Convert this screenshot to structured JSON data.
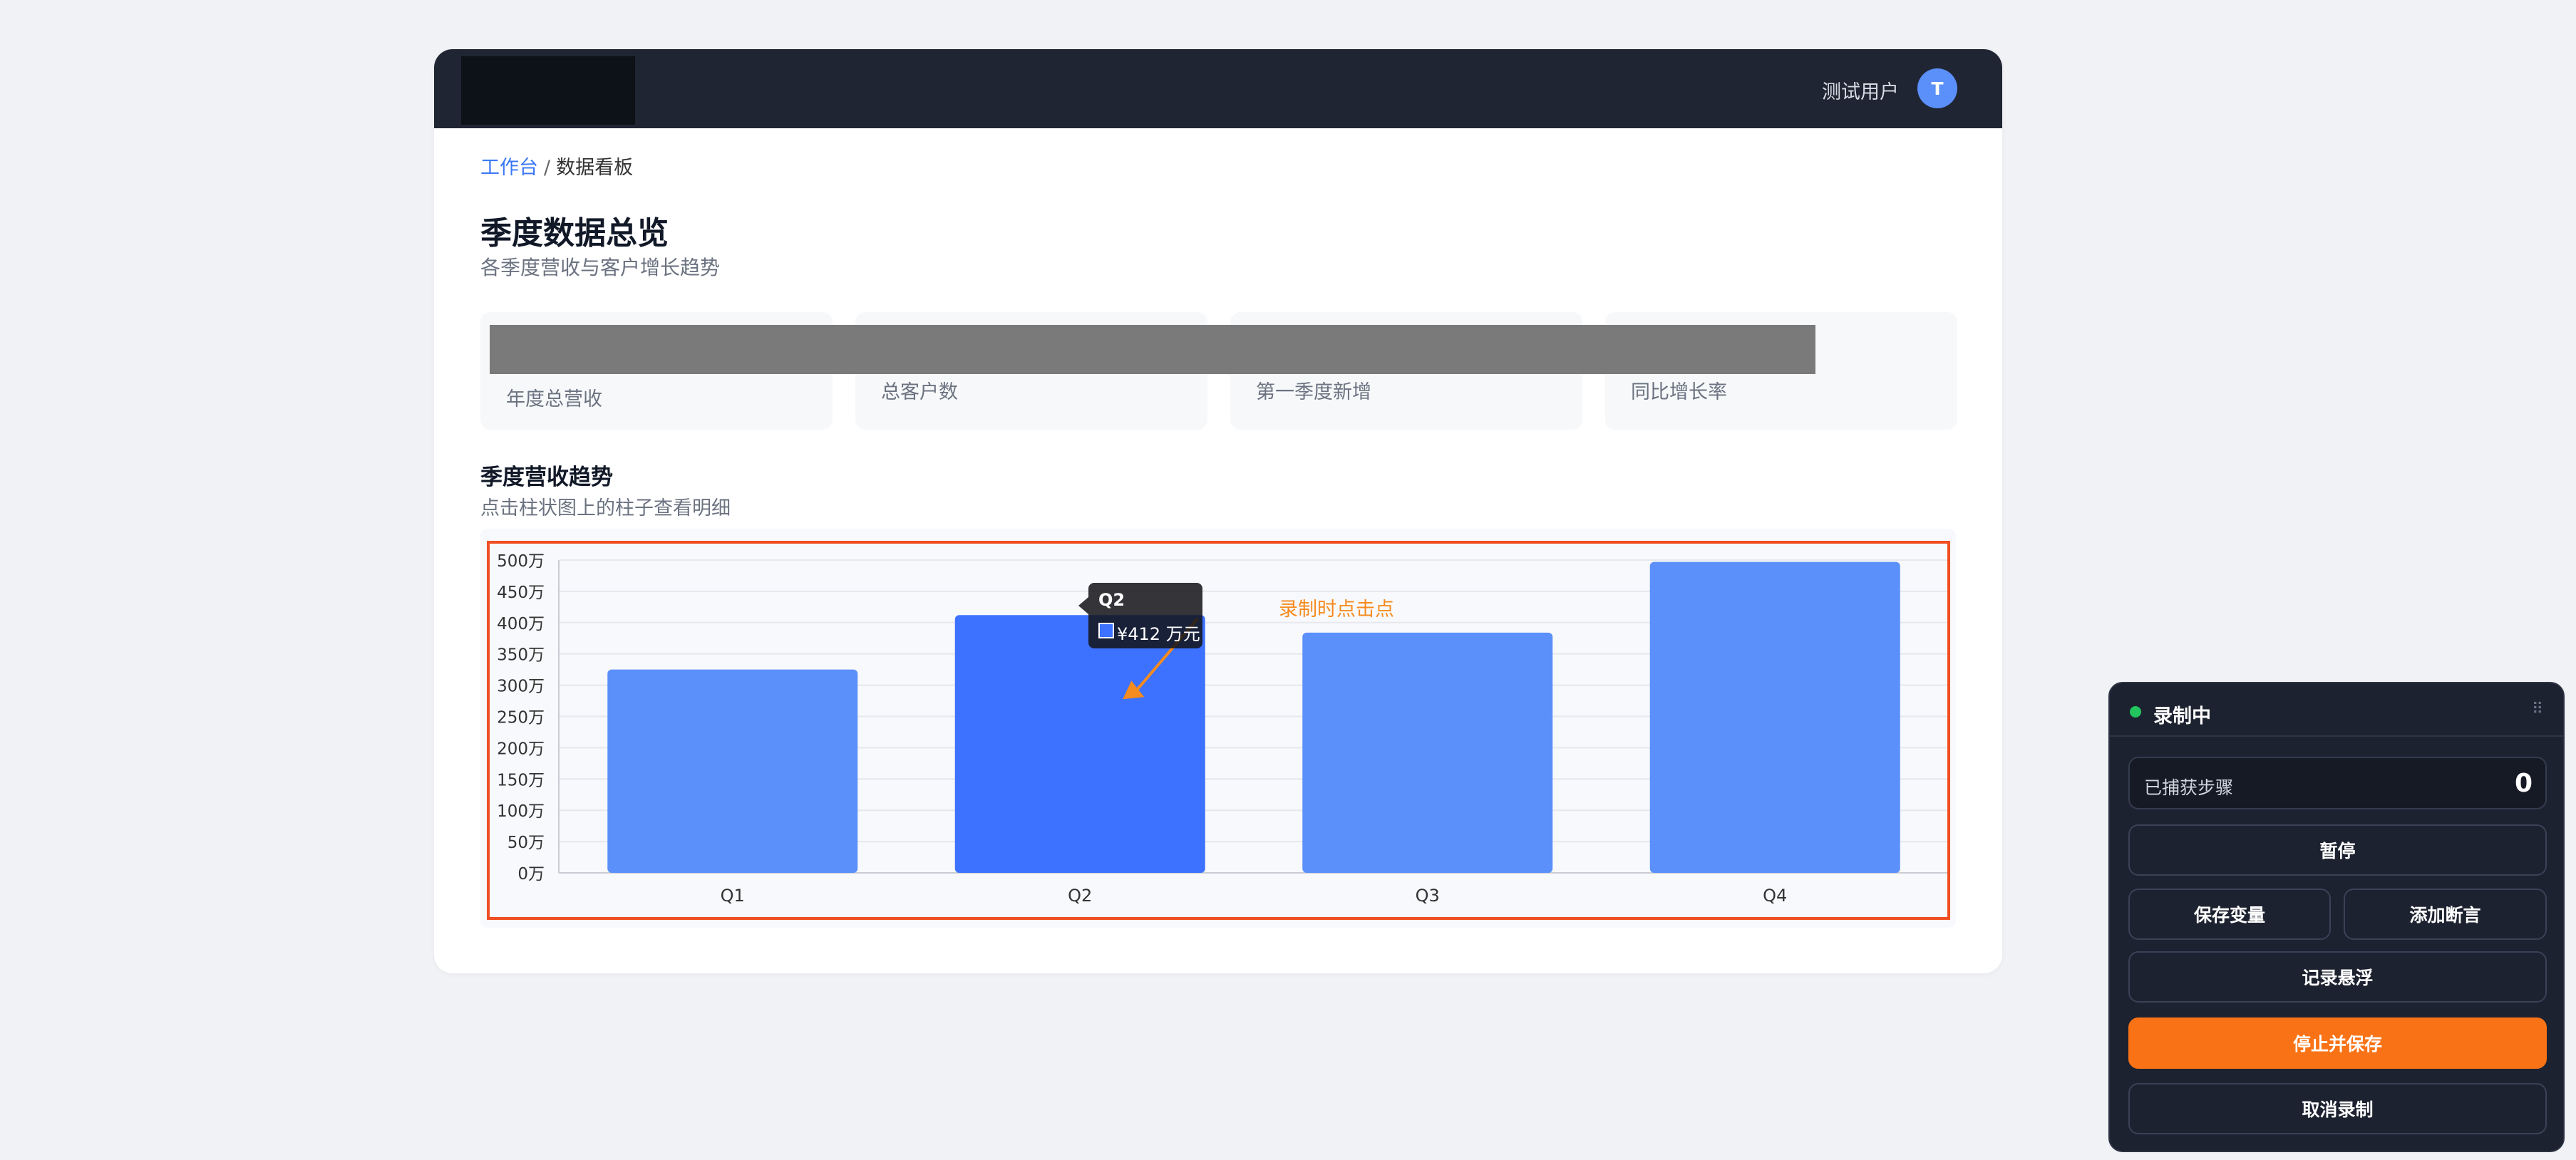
{
  "header": {
    "user_name": "测试用户",
    "avatar_initial": "T"
  },
  "breadcrumb": {
    "link": "工作台",
    "separator": "/",
    "current": "数据看板"
  },
  "page": {
    "title": "季度数据总览",
    "subtitle": "各季度营收与客户增长趋势"
  },
  "stats": [
    {
      "label": "年度总营收"
    },
    {
      "label": "总客户数"
    },
    {
      "label": "第一季度新增"
    },
    {
      "label": "同比增长率"
    }
  ],
  "section": {
    "title": "季度营收趋势",
    "subtitle": "点击柱状图上的柱子查看明细"
  },
  "chart_data": {
    "type": "bar",
    "categories": [
      "Q1",
      "Q2",
      "Q3",
      "Q4"
    ],
    "values": [
      325,
      412,
      384,
      497
    ],
    "unit": "万",
    "ylim": [
      0,
      500
    ],
    "y_ticks": [
      "0万",
      "50万",
      "100万",
      "150万",
      "200万",
      "250万",
      "300万",
      "350万",
      "400万",
      "450万",
      "500万"
    ],
    "grid": true,
    "highlighted": "Q2",
    "colors": {
      "bar": "#5b8ff9",
      "bar_active": "#3c72ff",
      "grid": "#e6e8ee",
      "axis": "#c9ccd3"
    },
    "tooltip": {
      "title": "Q2",
      "value": "¥412 万元"
    },
    "annotation": "录制时点击点"
  },
  "recorder": {
    "status": "录制中",
    "status_color": "#22c55e",
    "drag_icon": "drag-handle-icon",
    "steps_label": "已捕获步骤",
    "steps_count": "0",
    "pause": "暂停",
    "save_variable": "保存变量",
    "add_assertion": "添加断言",
    "record_hover": "记录悬浮",
    "stop_save": "停止并保存",
    "cancel": "取消录制",
    "accent": "#f97316"
  }
}
